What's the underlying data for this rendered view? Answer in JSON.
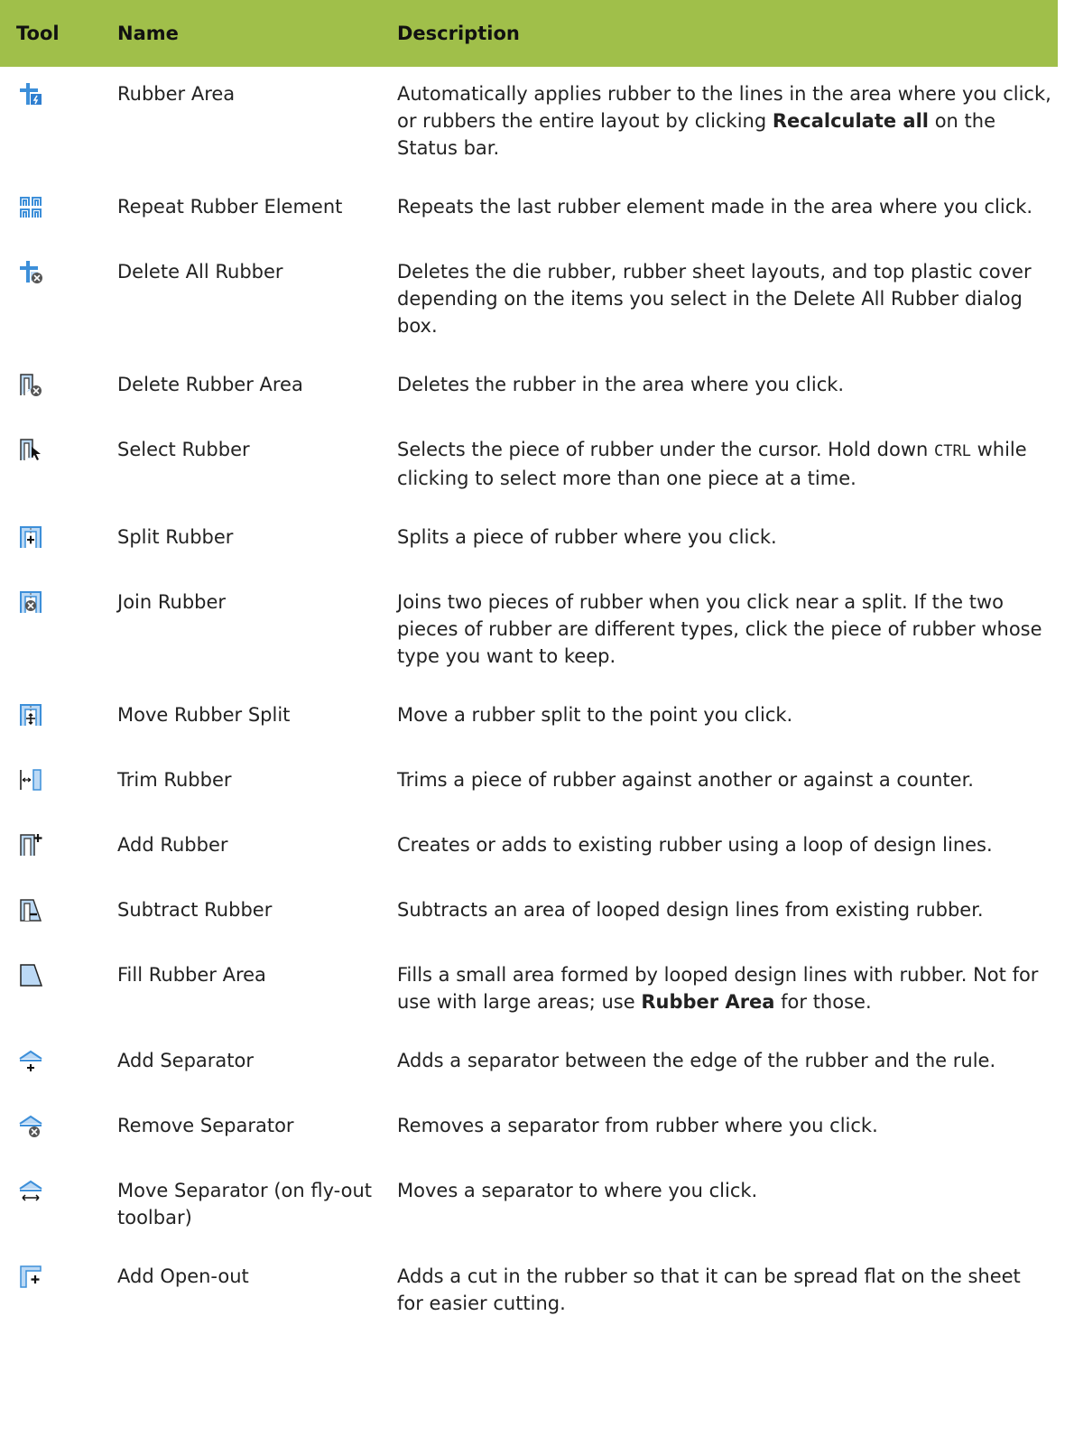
{
  "header": {
    "tool": "Tool",
    "name": "Name",
    "description": "Description"
  },
  "rows": [
    {
      "icon": "rubber-area-icon",
      "name": "Rubber Area",
      "desc_a": "Automatically applies rubber to the lines in the area where you click, or rubbers the entire layout by clicking ",
      "desc_b": "Recalculate all",
      "desc_c": " on the Status bar."
    },
    {
      "icon": "repeat-rubber-element-icon",
      "name": "Repeat Rubber Element",
      "desc_a": "Repeats the last rubber element made in the area where you click."
    },
    {
      "icon": "delete-all-rubber-icon",
      "name": "Delete All Rubber",
      "desc_a": "Deletes the die rubber, rubber sheet layouts, and top plastic cover depending on the items you select in the Delete All Rubber dialog box."
    },
    {
      "icon": "delete-rubber-area-icon",
      "name": "Delete Rubber Area",
      "desc_a": "Deletes the rubber in the area where you click."
    },
    {
      "icon": "select-rubber-icon",
      "name": "Select Rubber",
      "desc_a": "Selects the piece of rubber under the cursor. Hold down ",
      "desc_code": "CTRL",
      "desc_c": " while clicking to select more than one piece at a time."
    },
    {
      "icon": "split-rubber-icon",
      "name": "Split Rubber",
      "desc_a": "Splits a piece of rubber where you click."
    },
    {
      "icon": "join-rubber-icon",
      "name": "Join Rubber",
      "desc_a": "Joins two pieces of rubber when you click near a split. If the two pieces of rubber are different types, click the piece of rubber whose type you want to keep."
    },
    {
      "icon": "move-rubber-split-icon",
      "name": "Move Rubber Split",
      "desc_a": "Move a rubber split to the point you click."
    },
    {
      "icon": "trim-rubber-icon",
      "name": "Trim Rubber",
      "desc_a": "Trims a piece of rubber against another or against a counter."
    },
    {
      "icon": "add-rubber-icon",
      "name": "Add Rubber",
      "desc_a": "Creates or adds to existing rubber using a loop of design lines."
    },
    {
      "icon": "subtract-rubber-icon",
      "name": "Subtract Rubber",
      "desc_a": "Subtracts an area of looped design lines from existing rubber."
    },
    {
      "icon": "fill-rubber-area-icon",
      "name": "Fill Rubber Area",
      "desc_a": "Fills a small area formed by looped design lines with rubber. Not for use with large areas; use ",
      "desc_b": "Rubber Area",
      "desc_c": " for those."
    },
    {
      "icon": "add-separator-icon",
      "name": "Add Separator",
      "desc_a": "Adds a separator between the edge of the rubber and the rule."
    },
    {
      "icon": "remove-separator-icon",
      "name": "Remove Separator",
      "desc_a": "Removes a separator from rubber where you click."
    },
    {
      "icon": "move-separator-icon",
      "name": "Move Separator (on fly-out toolbar)",
      "desc_a": "Moves a separator to where you click."
    },
    {
      "icon": "add-open-out-icon",
      "name": "Add Open-out",
      "desc_a": "Adds a cut in the rubber so that it can be spread flat on the sheet for easier cutting."
    }
  ]
}
